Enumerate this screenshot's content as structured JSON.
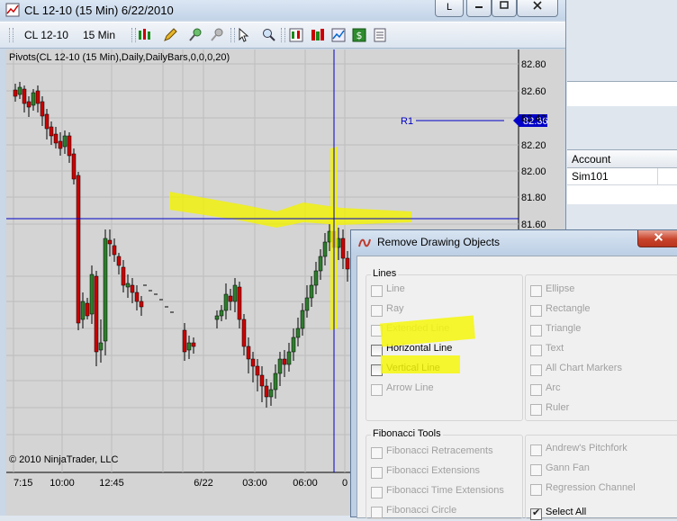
{
  "window": {
    "title": "CL 12-10 (15 Min)  6/22/2010",
    "btn_restore": "L",
    "btn_min": "▭",
    "btn_max": "◻",
    "btn_close": "✕"
  },
  "toolbar": {
    "instrument": "CL 12-10",
    "interval": "15 Min"
  },
  "chart": {
    "indicator_label": "Pivots(CL 12-10 (15 Min),Daily,DailyBars,0,0,0,20)",
    "copyright": "© 2010 NinjaTrader, LLC",
    "r1_label": "R1",
    "price_marker": "82.36",
    "hline_price_label": "81.60",
    "y_ticks": [
      "82.80",
      "82.60",
      "82.40",
      "82.20",
      "82.00",
      "81.80",
      "81.60"
    ],
    "x_ticks": [
      "7:15",
      "10:00",
      "12:45",
      "6/22",
      "03:00",
      "06:00",
      "0"
    ],
    "accent_up": "#2e7d2e",
    "accent_down": "#cc0000",
    "line_color": "#0000c8"
  },
  "side_panel": {
    "account_header": "Account",
    "account_value": "Sim101"
  },
  "dialog": {
    "title": "Remove Drawing Objects",
    "close_label": "x",
    "lines_group": "Lines",
    "fib_group": "Fibonacci Tools",
    "lines_left": [
      {
        "label": "Line",
        "enabled": false
      },
      {
        "label": "Ray",
        "enabled": false
      },
      {
        "label": "Extended Line",
        "enabled": false
      },
      {
        "label": "Horizontal Line",
        "enabled": true
      },
      {
        "label": "Vertical Line",
        "enabled": true
      },
      {
        "label": "Arrow Line",
        "enabled": false
      }
    ],
    "lines_right": [
      {
        "label": "Ellipse",
        "enabled": false
      },
      {
        "label": "Rectangle",
        "enabled": false
      },
      {
        "label": "Triangle",
        "enabled": false
      },
      {
        "label": "Text",
        "enabled": false
      },
      {
        "label": "All Chart Markers",
        "enabled": false
      },
      {
        "label": "Arc",
        "enabled": false
      },
      {
        "label": "Ruler",
        "enabled": false
      }
    ],
    "fib_left": [
      {
        "label": "Fibonacci Retracements",
        "enabled": false
      },
      {
        "label": "Fibonacci Extensions",
        "enabled": false
      },
      {
        "label": "Fibonacci Time Extensions",
        "enabled": false
      },
      {
        "label": "Fibonacci Circle",
        "enabled": false
      }
    ],
    "fib_right": [
      {
        "label": "Andrew's Pitchfork",
        "enabled": false
      },
      {
        "label": "Gann Fan",
        "enabled": false
      },
      {
        "label": "Regression Channel",
        "enabled": false
      }
    ],
    "select_all": "Select All"
  }
}
